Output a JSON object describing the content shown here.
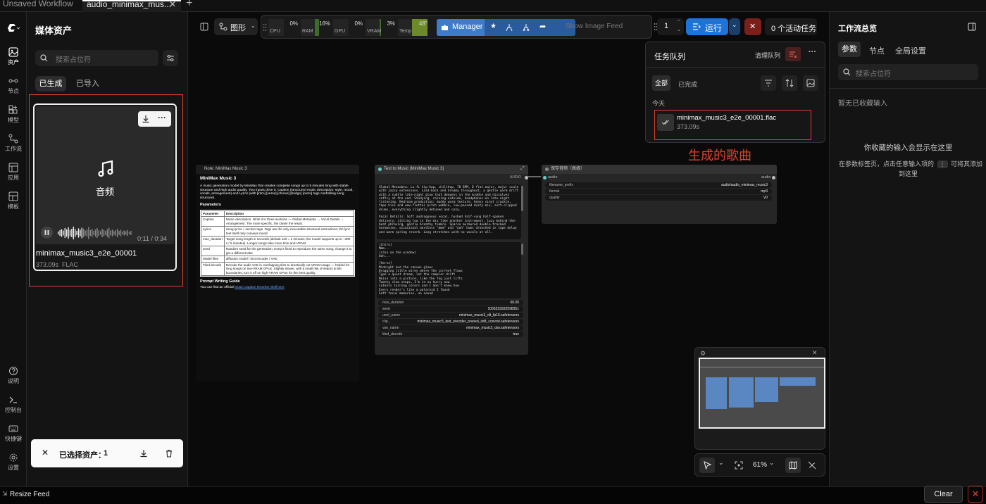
{
  "tabs": {
    "workflow": "Unsaved Workflow",
    "active": "audio_minimax_mus...",
    "close": "✕",
    "add": "+"
  },
  "rail": {
    "assets": "资产",
    "nodes": "节点",
    "models": "模型",
    "workflows": "工作流",
    "apps": "应用",
    "templates": "模板",
    "help": "说明",
    "console": "控制台",
    "shortcuts": "快捷键",
    "settings": "设置"
  },
  "media": {
    "title": "媒体资产",
    "search_placeholder": "搜索占位符",
    "tab_generated": "已生成",
    "tab_imported": "已导入",
    "card": {
      "type_label": "音频",
      "time": "0:11 / 0:34",
      "name": "minimax_music3_e2e_00001",
      "meta": "373.09s  FLAC",
      "progress": 0.32
    },
    "selection": {
      "label": "已选择资产：",
      "count": "1"
    }
  },
  "toolbar": {
    "graph_mode": "图形",
    "stats": [
      {
        "label": "CPU",
        "value": "0%",
        "fill": 0.0,
        "color": "#3a3a3a"
      },
      {
        "label": "RAM",
        "value": "16%",
        "fill": 0.16,
        "color": "#3d6b2a"
      },
      {
        "label": "GPU",
        "value": "0%",
        "fill": 0.0,
        "color": "#3a3a3a"
      },
      {
        "label": "VRAM",
        "value": "3%",
        "fill": 0.03,
        "color": "#3d6b2a"
      },
      {
        "label": "Temp",
        "value": "48°",
        "fill": 1.0,
        "color": "#6d8a2a"
      }
    ],
    "manager": "Manager",
    "show_feed": "Show Image Feed",
    "batch": "1",
    "run": "运行",
    "active_tasks": "0 个活动任务",
    "accent": "#1e73d8",
    "danger": "#b3261e"
  },
  "queue": {
    "title": "任务队列",
    "clear": "清理队列",
    "tab_all": "全部",
    "tab_done": "已完成",
    "today": "今天",
    "item": {
      "name": "minimax_music3_e2e_00001.flac",
      "duration": "373.09s"
    }
  },
  "annotation": {
    "text": "生成的歌曲",
    "color": "#e0402e"
  },
  "note_node": {
    "header": "Note: MiniMax Music 3",
    "title": "MiniMax Music 3",
    "intro": "A music generation model by MiniMax that creates complete songs up to 5 minutes long with stable structure and high audio quality. Two inputs drive it: Caption (structured music description: style, mood, vocals, arrangement) and Lyrics (with [intro] [verse] [chorus] [bridge] [outro] tags controlling song structure).",
    "params_title": "Parameters",
    "col_param": "Parameter",
    "col_desc": "Description",
    "rows": [
      {
        "p": "Caption",
        "d": "Music description. Write it in three sections — Global Metadata → Vocal Details → Arrangement. The more specific, the closer the result."
      },
      {
        "p": "Lyrics",
        "d": "Song lyrics + section tags. Tags are the only executable structural instructions; the lyric text itself only conveys mood."
      },
      {
        "p": "max_duration",
        "d": "Target song length in seconds (default 120 = 2 minutes; the model supports up to ~300 s / 5 minutes). Longer songs take more time and VRAM."
      },
      {
        "p": "seed",
        "d": "Random seed for the generation. Keep it fixed to reproduce the same song; change it to get a different take."
      },
      {
        "p": "Model files",
        "d": "diffusion model / text encoder / VAE."
      },
      {
        "p": "Tiled decode",
        "d": "Decode the audio VAE in overlapping tiles to drastically cut VRAM usage — helpful for long songs on low-VRAM GPUs. Slightly slower, with a small risk of seams at tile boundaries; turn it off on high-VRAM GPUs for the best quality."
      }
    ],
    "guide_title": "Prompt Writing Guide",
    "guide_text": "You can find an official",
    "guide_link": "Music Caption Rewriter Skill here"
  },
  "t2m_node": {
    "header": "Text to Music (MiniMax Music 3)",
    "output": "AUDIO",
    "caption": "Global Metadata: Lo-fi hip-hop, chillhop, 78 BPM, D flat major, major scale with jazzy extensions. Laid-back and dreamy throughout, a gentle warm drift with a subtle late-night glow that deepens in the middle and dissolves softly at the end. Studying, raining-outside, headphones-on late-night listening. Bedroom production: muddy warm texture, heavy vinyl crackle, tape hiss and wow-flutter pitch wobble, low-passed dusty mix, soft-clipped drums, everything slightly detuned and cozy.\n\nVocal Details: Soft androgynous vocal, hushed half-sung half-spoken delivery, sitting low in the mix like another instrument, lazy behind-the-beat phrasing, gentle breathy timbre. Sparse murmured double-tracked harmonies, occasional wordless \"mmm\" and \"ooh\" hums drenched in tape delay and warm spring reverb. Long stretches with no vocals at all.",
    "lyrics": "[Intro]\nMmm...\n(rain on the window)\nOoh...\n\n[Verse]\nMidnight and the canvas glows\nDragging little wires where the current flows\nType a quiet dream, let the sampler drift\nNoise into a picture, like the fog just lifts\nTwenty slow steps, I'm in no hurry now\nLatents turning colors and I don't know how\nEvery render's like a polaroid I found\nSoft focus memories, no sound",
    "widgets": [
      {
        "k": "max_duration",
        "v": "60.00"
      },
      {
        "k": "seed",
        "v": "1035233932598351"
      },
      {
        "k": "unet_name",
        "v": "minimax_music3_dit_fp16.safetensors"
      },
      {
        "k": "clip...",
        "v": "minimax_music3_text_encoder_pruned_int8_convrot.safetensors"
      },
      {
        "k": "vae_name",
        "v": "minimax_music3_dav.safetensors"
      },
      {
        "k": "tiled_decode",
        "v": "true"
      }
    ]
  },
  "save_node": {
    "header": "保存音频（高级）",
    "input": "audio",
    "output": "audio",
    "widgets": [
      {
        "k": "filename_prefix",
        "v": "audio/audio_minimax_music3"
      },
      {
        "k": "format",
        "v": "mp3"
      },
      {
        "k": "quality",
        "v": "V0"
      }
    ]
  },
  "canvas_controls": {
    "zoom": "61%"
  },
  "overview": {
    "title": "工作流总览",
    "tab_params": "参数",
    "tab_nodes": "节点",
    "tab_global": "全局设置",
    "search_placeholder": "搜索占位符",
    "empty": "暂无已收藏输入",
    "hint_title": "你收藏的输入会显示在这里",
    "hint_line1": "在参数标签页，点击任意输入项的",
    "hint_line2": "可将其添加",
    "hint_line3": "到这里",
    "more_glyph": "⋮"
  },
  "footer": {
    "resize_feed": "Resize Feed",
    "clear": "Clear"
  }
}
